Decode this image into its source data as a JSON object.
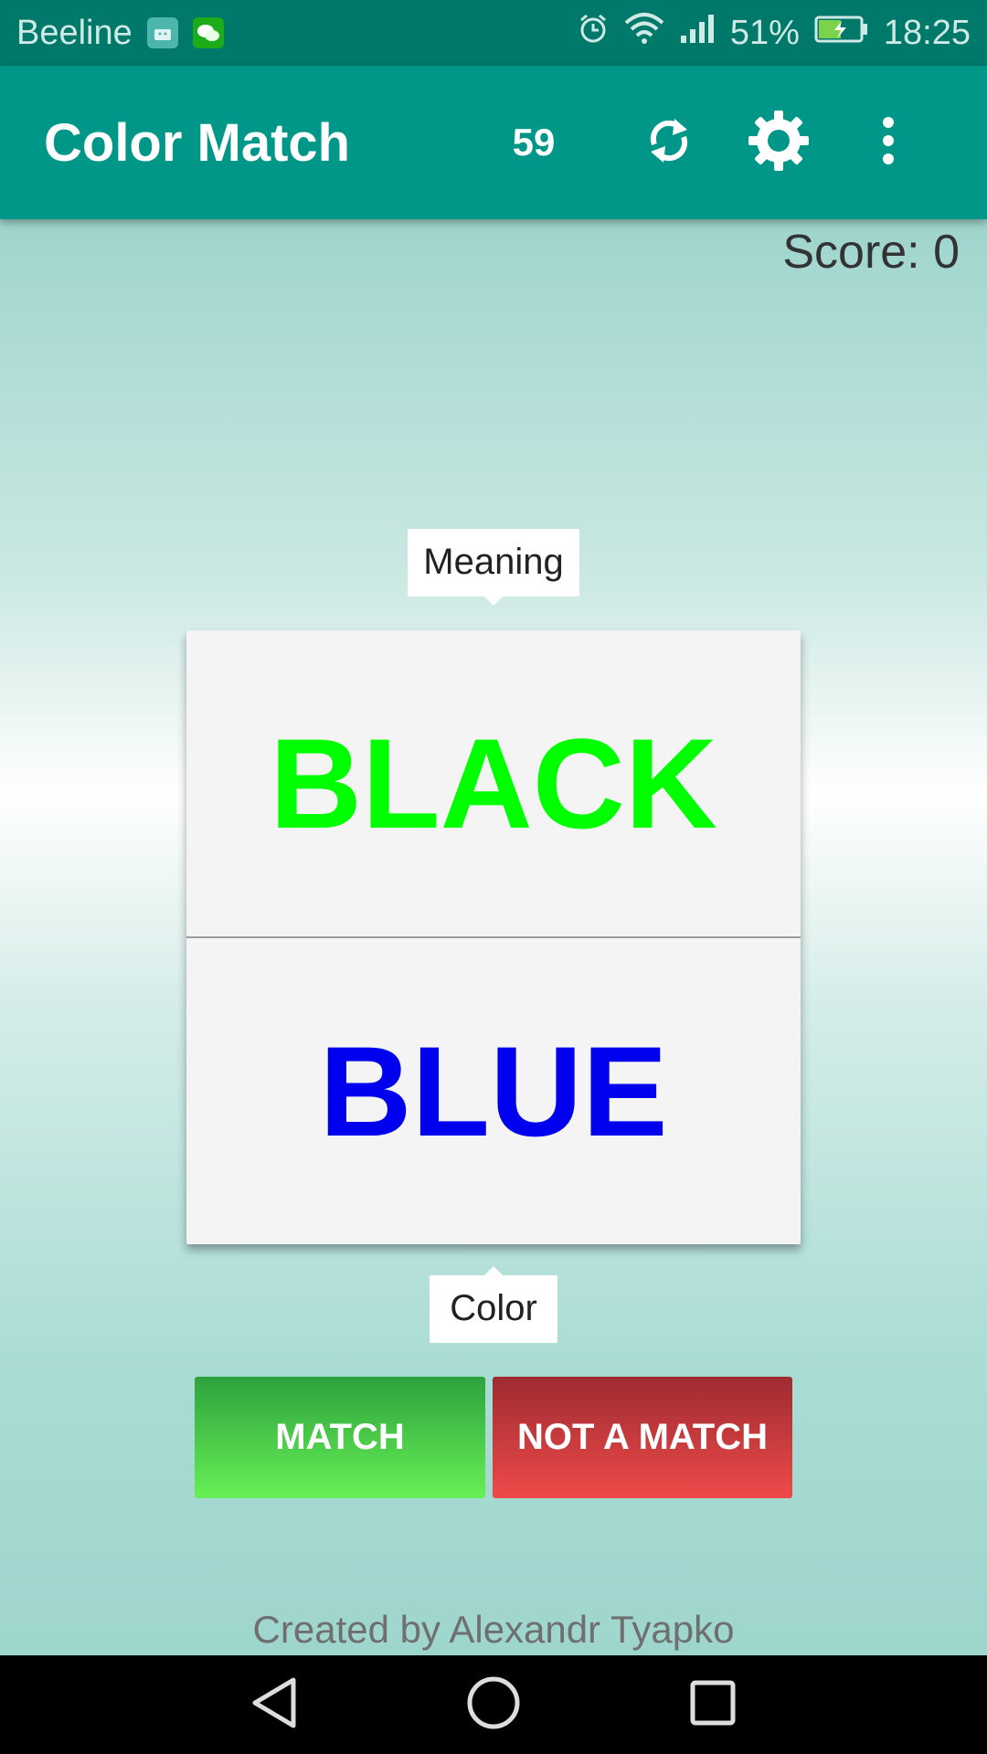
{
  "status_bar": {
    "carrier": "Beeline",
    "battery": "51%",
    "time": "18:25",
    "icons": [
      "android-icon",
      "wechat-icon",
      "alarm-icon",
      "wifi-icon",
      "signal-icon",
      "battery-icon"
    ]
  },
  "app_bar": {
    "title": "Color Match",
    "timer": "59",
    "actions": [
      "refresh-icon",
      "settings-icon",
      "more-vert-icon"
    ]
  },
  "game": {
    "score": "Score: 0",
    "meaning_label": "Meaning",
    "color_label": "Color",
    "meaning_word": "BLACK",
    "meaning_word_color": "#00ff00",
    "color_word": "BLUE",
    "color_word_color": "#0000ee",
    "match_label": "MATCH",
    "no_match_label": "NOT A MATCH"
  },
  "footer": {
    "credit": "Created by Alexandr Tyapko"
  },
  "colors": {
    "primary": "#009688",
    "primary_dark": "#00786a",
    "match_green": "#4cd34a",
    "no_match_red": "#e0403f"
  }
}
